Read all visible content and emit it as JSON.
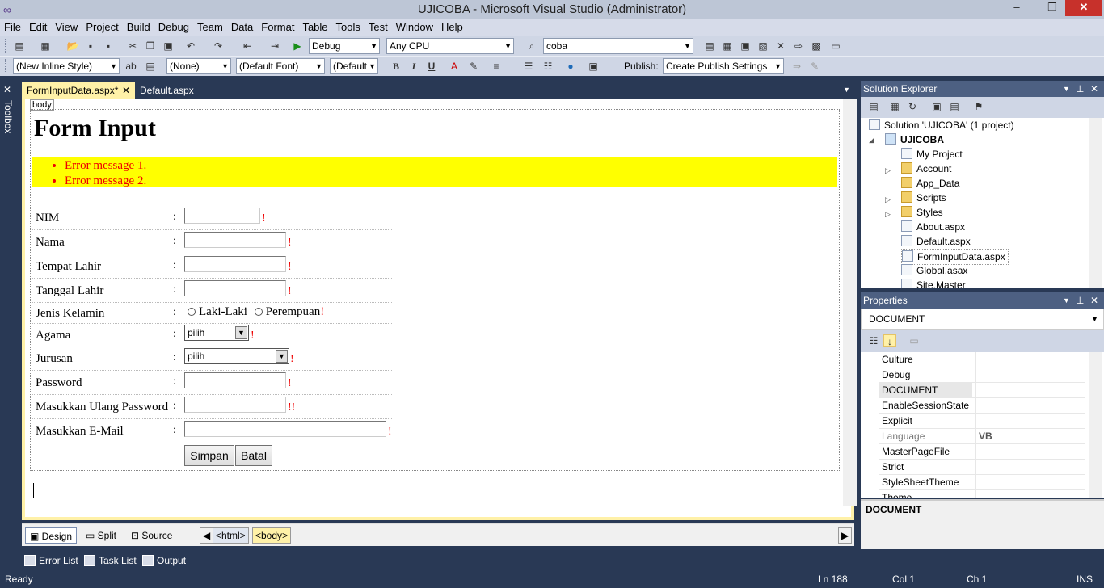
{
  "window": {
    "title": "UJICOBA - Microsoft Visual Studio (Administrator)",
    "minimize": "–",
    "restore": "❐",
    "close": "✕"
  },
  "menu": [
    "File",
    "Edit",
    "View",
    "Project",
    "Build",
    "Debug",
    "Team",
    "Data",
    "Format",
    "Table",
    "Tools",
    "Test",
    "Window",
    "Help"
  ],
  "toolbar1": {
    "config": "Debug",
    "platform": "Any CPU",
    "find": "coba"
  },
  "toolbar2": {
    "style": "(New Inline Style)",
    "block": "(None)",
    "font": "(Default Font)",
    "size": "(Default",
    "bold": "B",
    "italic": "I",
    "underline": "U",
    "publish_label": "Publish:",
    "publish": "Create Publish Settings"
  },
  "toolbox": {
    "label": "Toolbox"
  },
  "tabs": [
    {
      "label": "FormInputData.aspx*",
      "close": "✕"
    },
    {
      "label": "Default.aspx"
    }
  ],
  "design": {
    "body_tag": "body",
    "heading": "Form Input",
    "errors": [
      "Error message 1.",
      "Error message 2."
    ],
    "colon": ":",
    "required_mark": "!",
    "double_mark": "!!",
    "rows": [
      "NIM",
      "Nama",
      "Tempat Lahir",
      "Tanggal Lahir",
      "Jenis Kelamin",
      "Agama",
      "Jurusan",
      "Password",
      "Masukkan Ulang Password",
      "Masukkan E-Mail"
    ],
    "gender_options": [
      "Laki-Laki",
      "Perempuan"
    ],
    "select_placeholder": "pilih",
    "buttons": {
      "save": "Simpan",
      "cancel": "Batal"
    }
  },
  "view_bar": {
    "design": "Design",
    "split": "Split",
    "source": "Source",
    "crumbs": [
      "<html>",
      "<body>"
    ]
  },
  "solution_explorer": {
    "title": "Solution Explorer",
    "items": [
      {
        "label": "Solution 'UJICOBA' (1 project)"
      },
      {
        "label": "UJICOBA"
      },
      {
        "label": "My Project"
      },
      {
        "label": "Account"
      },
      {
        "label": "App_Data"
      },
      {
        "label": "Scripts"
      },
      {
        "label": "Styles"
      },
      {
        "label": "About.aspx"
      },
      {
        "label": "Default.aspx"
      },
      {
        "label": "FormInputData.aspx"
      },
      {
        "label": "Global.asax"
      },
      {
        "label": "Site.Master"
      }
    ]
  },
  "properties": {
    "title": "Properties",
    "object": "DOCUMENT",
    "rows": [
      {
        "name": "Culture",
        "value": ""
      },
      {
        "name": "Debug",
        "value": ""
      },
      {
        "name": "DOCUMENT",
        "value": ""
      },
      {
        "name": "EnableSessionState",
        "value": ""
      },
      {
        "name": "Explicit",
        "value": ""
      },
      {
        "name": "Language",
        "value": "VB"
      },
      {
        "name": "MasterPageFile",
        "value": ""
      },
      {
        "name": "Strict",
        "value": ""
      },
      {
        "name": "StyleSheetTheme",
        "value": ""
      },
      {
        "name": "Theme",
        "value": ""
      }
    ],
    "description": "DOCUMENT"
  },
  "tool_tabs": [
    "Error List",
    "Task List",
    "Output"
  ],
  "status": {
    "state": "Ready",
    "line": "Ln 188",
    "col": "Col 1",
    "ch": "Ch 1",
    "mode": "INS"
  }
}
